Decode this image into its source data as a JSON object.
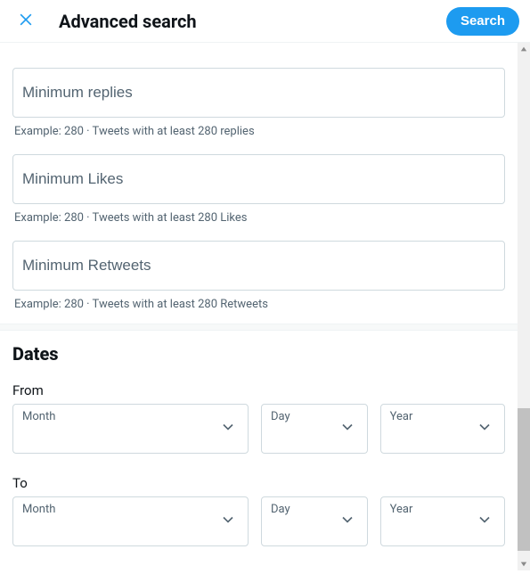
{
  "header": {
    "title": "Advanced search",
    "search_button": "Search"
  },
  "engagement": {
    "min_replies": {
      "placeholder": "Minimum replies",
      "hint": "Example: 280 · Tweets with at least 280 replies"
    },
    "min_likes": {
      "placeholder": "Minimum Likes",
      "hint": "Example: 280 · Tweets with at least 280 Likes"
    },
    "min_retweets": {
      "placeholder": "Minimum Retweets",
      "hint": "Example: 280 · Tweets with at least 280 Retweets"
    }
  },
  "dates": {
    "section_title": "Dates",
    "from_label": "From",
    "to_label": "To",
    "month_label": "Month",
    "day_label": "Day",
    "year_label": "Year"
  }
}
